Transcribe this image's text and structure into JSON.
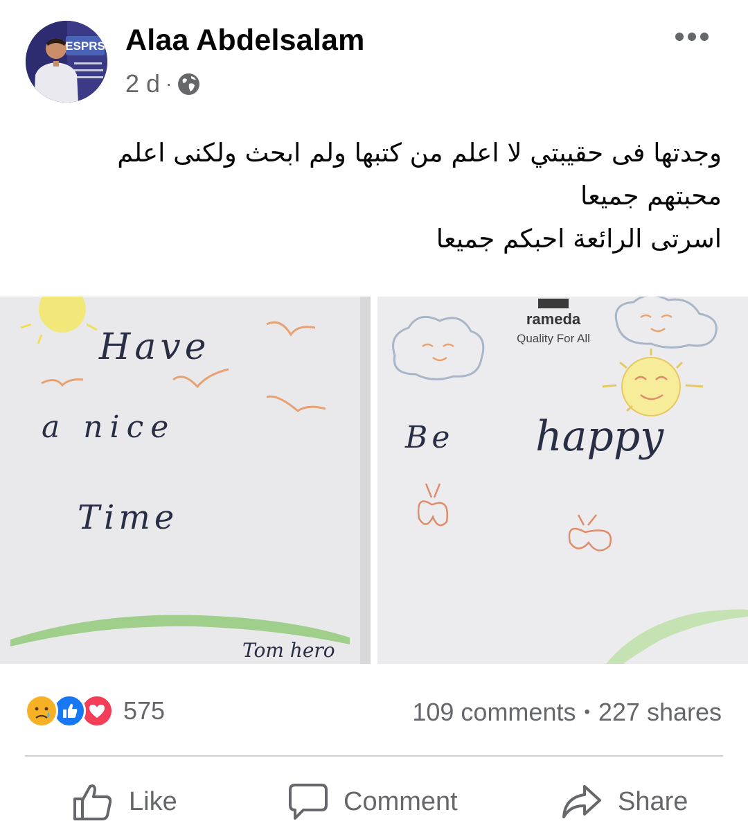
{
  "post": {
    "author": "Alaa Abdelsalam",
    "time": "2 d",
    "separator": "·",
    "privacy_icon": "globe-icon",
    "more_icon": "more-options-icon",
    "avatar_banner": "ESPRS"
  },
  "caption": {
    "lines": [
      "وجدتها فى حقيبتي لا اعلم من كتبها ولم ابحث ولكنى اعلم",
      "محبتهم جميعا",
      "اسرتى الرائعة احبكم جميعا"
    ]
  },
  "photos": {
    "left": {
      "texts": [
        "Have",
        "a nice",
        "Time",
        "Tom hero"
      ]
    },
    "right": {
      "brand": "rameda",
      "tagline": "Quality For All",
      "texts": [
        "Be",
        "happy"
      ]
    }
  },
  "stats": {
    "reaction_count": "575",
    "comments": "109 comments",
    "dot": "•",
    "shares": "227 shares",
    "reactions": [
      "sad-icon",
      "like-icon",
      "love-icon"
    ]
  },
  "actions": {
    "like": "Like",
    "comment": "Comment",
    "share": "Share"
  },
  "colors": {
    "text_primary": "#050505",
    "text_secondary": "#65676b",
    "like_blue": "#1877f2",
    "love_red": "#f33e58",
    "sad_yellow": "#f7b125",
    "divider": "#ced0d4"
  }
}
